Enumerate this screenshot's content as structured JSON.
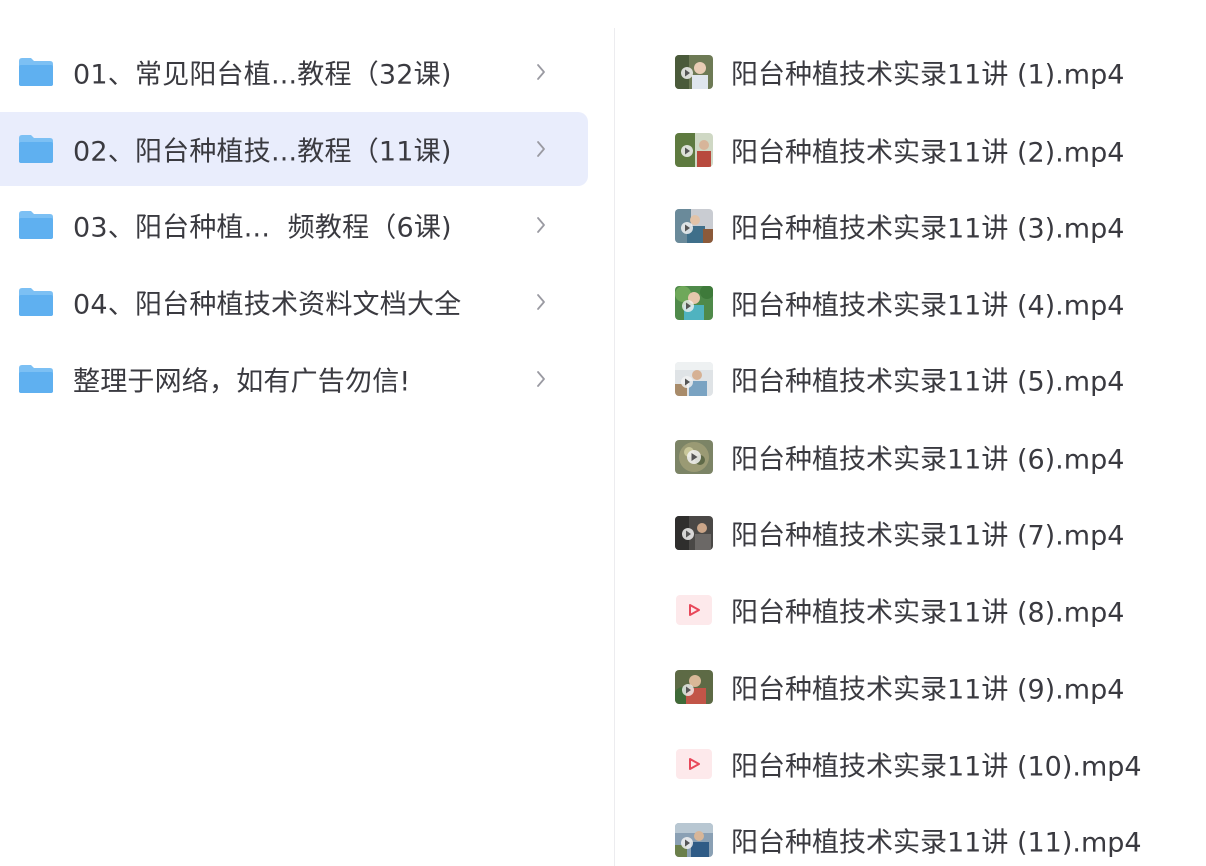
{
  "folders": [
    {
      "label": "01、常见阳台植...教程（32课)",
      "selected": false
    },
    {
      "label": "02、阳台种植技...教程（11课)",
      "selected": true
    },
    {
      "label": "03、阳台种植...  频教程（6课)",
      "selected": false
    },
    {
      "label": "04、阳台种植技术资料文档大全",
      "selected": false
    },
    {
      "label": "整理于网络，如有广告勿信!",
      "selected": false
    }
  ],
  "files": [
    {
      "label": "阳台种植技术实录11讲 (1).mp4",
      "icon": "video-thumbnail-icon"
    },
    {
      "label": "阳台种植技术实录11讲 (2).mp4",
      "icon": "video-thumbnail-icon"
    },
    {
      "label": "阳台种植技术实录11讲 (3).mp4",
      "icon": "video-thumbnail-icon"
    },
    {
      "label": "阳台种植技术实录11讲 (4).mp4",
      "icon": "video-thumbnail-icon"
    },
    {
      "label": "阳台种植技术实录11讲 (5).mp4",
      "icon": "video-thumbnail-icon"
    },
    {
      "label": "阳台种植技术实录11讲 (6).mp4",
      "icon": "video-thumbnail-icon"
    },
    {
      "label": "阳台种植技术实录11讲 (7).mp4",
      "icon": "video-thumbnail-icon"
    },
    {
      "label": "阳台种植技术实录11讲 (8).mp4",
      "icon": "video-file-icon"
    },
    {
      "label": "阳台种植技术实录11讲 (9).mp4",
      "icon": "video-thumbnail-icon"
    },
    {
      "label": "阳台种植技术实录11讲 (10).mp4",
      "icon": "video-file-icon"
    },
    {
      "label": "阳台种植技术实录11讲 (11).mp4",
      "icon": "video-thumbnail-icon"
    }
  ],
  "colors": {
    "selected_row_bg": "#e9edfc",
    "folder_blue": "#5fb0f0",
    "text": "#3a3a40",
    "chevron": "#9a9aa2",
    "play_red": "#e8485a"
  }
}
